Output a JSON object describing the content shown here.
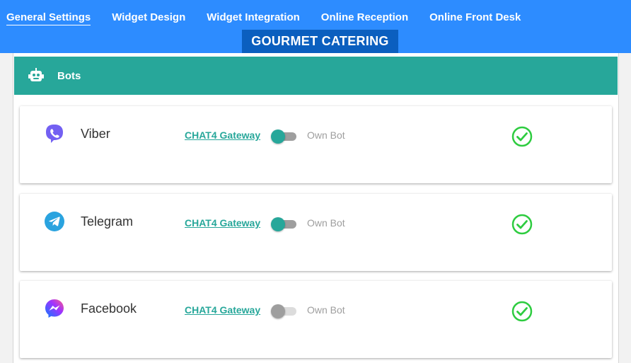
{
  "nav": {
    "items": [
      {
        "label": "General Settings",
        "active": true
      },
      {
        "label": "Widget Design",
        "active": false
      },
      {
        "label": "Widget Integration",
        "active": false
      },
      {
        "label": "Online Reception",
        "active": false
      },
      {
        "label": "Online Front Desk",
        "active": false
      }
    ]
  },
  "company": {
    "name": "GOURMET CATERING"
  },
  "section": {
    "title": "Bots",
    "icon": "robot-icon"
  },
  "bots": [
    {
      "name": "Viber",
      "icon": "viber-icon",
      "gateway_label": "CHAT4 Gateway",
      "own_bot_label": "Own Bot",
      "toggle_on": true,
      "status": "check-circle-icon"
    },
    {
      "name": "Telegram",
      "icon": "telegram-icon",
      "gateway_label": "CHAT4 Gateway",
      "own_bot_label": "Own Bot",
      "toggle_on": true,
      "status": "check-circle-icon"
    },
    {
      "name": "Facebook",
      "icon": "messenger-icon",
      "gateway_label": "CHAT4 Gateway",
      "own_bot_label": "Own Bot",
      "toggle_on": false,
      "status": "check-circle-icon"
    }
  ],
  "colors": {
    "topbar": "#2d8cff",
    "company_bg": "#0b5fbf",
    "accent": "#27a79a",
    "check": "#2ecc40"
  }
}
